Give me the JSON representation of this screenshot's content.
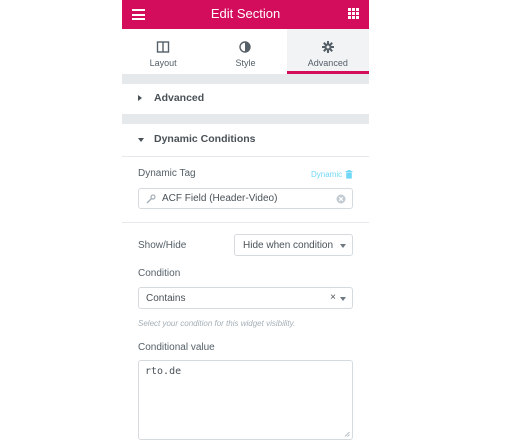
{
  "header": {
    "title": "Edit Section",
    "menu_icon": "hamburger-icon",
    "apps_icon": "grid-icon",
    "accent_color": "#d30c5c"
  },
  "tabs": [
    {
      "label": "Layout",
      "icon": "columns-icon",
      "active": false
    },
    {
      "label": "Style",
      "icon": "half-circle-icon",
      "active": false
    },
    {
      "label": "Advanced",
      "icon": "gear-icon",
      "active": true
    }
  ],
  "sections": {
    "advanced": {
      "label": "Advanced",
      "expanded": false
    },
    "dynamic_conditions": {
      "label": "Dynamic Conditions",
      "expanded": true
    }
  },
  "dynamic_tag": {
    "label": "Dynamic Tag",
    "link_label": "Dynamic",
    "value": "ACF Field (Header-Video)"
  },
  "show_hide": {
    "label": "Show/Hide",
    "value": "Hide when condition"
  },
  "condition": {
    "label": "Condition",
    "value": "Contains",
    "hint": "Select your condition for this widget visibility."
  },
  "conditional_value": {
    "label": "Conditional value",
    "value": "rto.de"
  }
}
